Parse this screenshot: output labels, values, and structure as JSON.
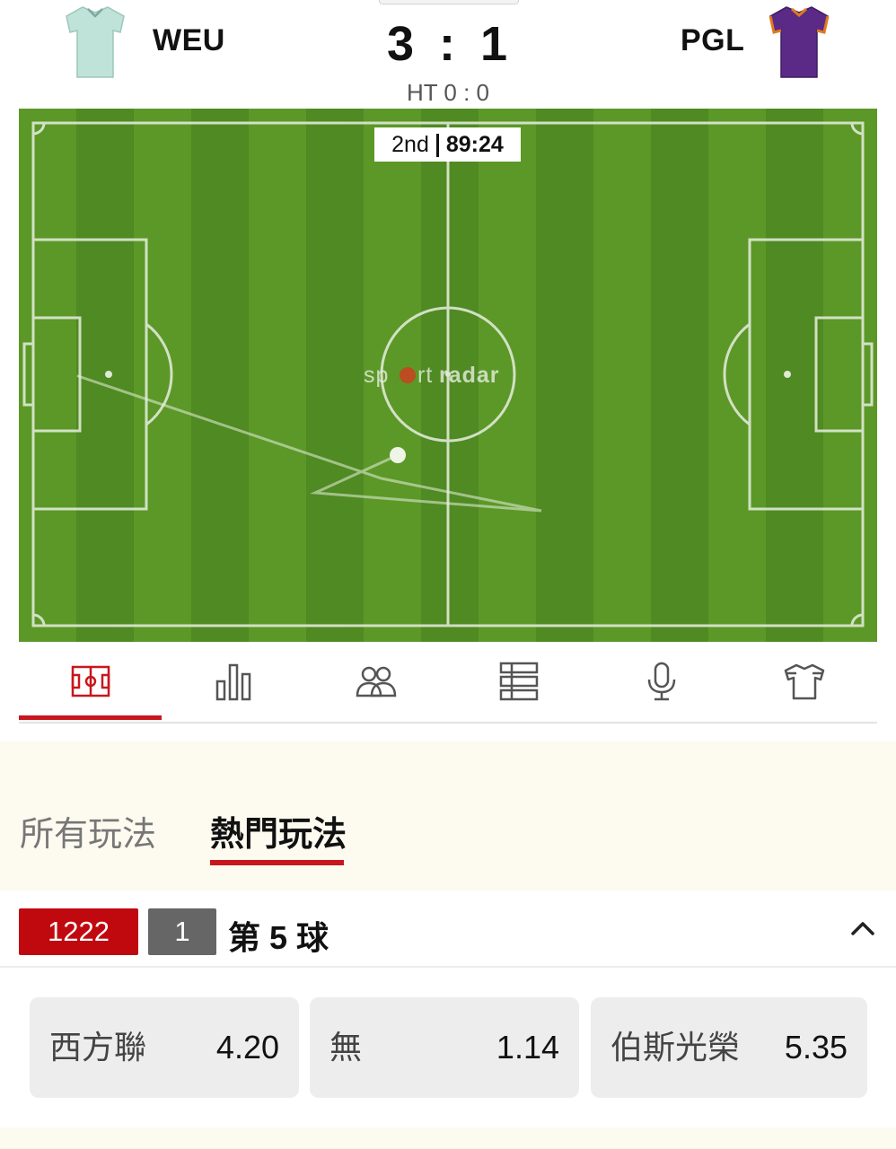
{
  "match": {
    "home": {
      "short_name": "WEU",
      "jersey_color": "#bfe3d8",
      "jersey_icon": "jersey-icon"
    },
    "away": {
      "short_name": "PGL",
      "jersey_color": "#5b2a86",
      "jersey_trim": "#e07a1e",
      "jersey_icon": "jersey-icon"
    },
    "score_home": "3",
    "score_sep": ":",
    "score_away": "1",
    "halftime": "HT 0 : 0"
  },
  "pitch": {
    "period": "2nd",
    "clock": "89:24",
    "brand_logo": "sportradar",
    "grass_colors": [
      "#4f8a22",
      "#5e9a2a"
    ]
  },
  "tabs": [
    {
      "icon": "pitch-icon",
      "active": true
    },
    {
      "icon": "stats-bar-icon",
      "active": false
    },
    {
      "icon": "lineups-icon",
      "active": false
    },
    {
      "icon": "list-icon",
      "active": false
    },
    {
      "icon": "microphone-icon",
      "active": false
    },
    {
      "icon": "shirt-icon",
      "active": false
    }
  ],
  "market_tabs": {
    "all": "所有玩法",
    "hot": "熱門玩法"
  },
  "market": {
    "code": "1222",
    "count": "1",
    "title": "第 5 球",
    "collapse_icon": "chevron-up-icon",
    "odds": [
      {
        "label": "西方聯",
        "value": "4.20"
      },
      {
        "label": "無",
        "value": "1.14"
      },
      {
        "label": "伯斯光榮",
        "value": "5.35"
      }
    ]
  },
  "colors": {
    "accent": "#c8161d",
    "badge_red": "#c0090f",
    "badge_gray": "#666666",
    "band": "#fdfbf0"
  }
}
